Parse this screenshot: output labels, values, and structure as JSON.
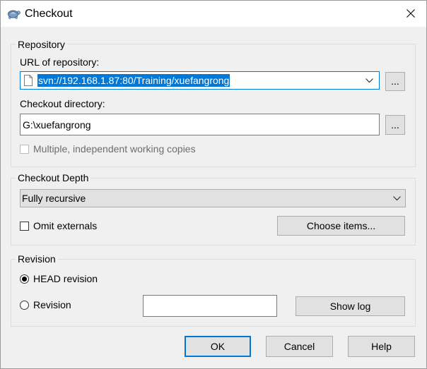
{
  "window": {
    "title": "Checkout",
    "icon": "tortoisesvn-icon",
    "close_icon": "close-icon"
  },
  "repository": {
    "group_label": "Repository",
    "url_label": "URL of repository:",
    "url_value": "svn://192.168.1.87:80/Training/xuefangrong",
    "url_icon": "file-icon",
    "url_browse_label": "...",
    "dir_label": "Checkout directory:",
    "dir_value": "G:\\xuefangrong",
    "dir_browse_label": "...",
    "multiple_copies_label": "Multiple, independent working copies",
    "multiple_copies_checked": false,
    "multiple_copies_disabled": true
  },
  "depth": {
    "group_label": "Checkout Depth",
    "selected": "Fully recursive",
    "omit_externals_label": "Omit externals",
    "omit_externals_checked": false,
    "choose_items_label": "Choose items..."
  },
  "revision": {
    "group_label": "Revision",
    "head_label": "HEAD revision",
    "head_selected": true,
    "revision_label": "Revision",
    "revision_selected": false,
    "revision_value": "",
    "show_log_label": "Show log"
  },
  "buttons": {
    "ok": "OK",
    "cancel": "Cancel",
    "help": "Help",
    "default": "ok"
  },
  "colors": {
    "accent": "#0078d7",
    "dialog_bg": "#f0f0f0",
    "selection_text": "#ffffff",
    "disabled_text": "#6d6d6d"
  }
}
